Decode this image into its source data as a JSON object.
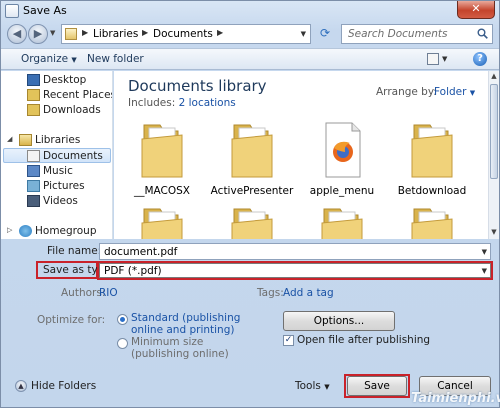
{
  "window": {
    "title": "Save As",
    "close_glyph": "✕"
  },
  "nav": {
    "back_glyph": "◀",
    "forward_glyph": "▶",
    "breadcrumb": [
      "Libraries",
      "Documents"
    ],
    "search_placeholder": "Search Documents"
  },
  "toolbar": {
    "organize": "Organize",
    "new_folder": "New folder",
    "help": "?"
  },
  "sidebar": {
    "items": [
      {
        "label": "Desktop",
        "icon": "desktop-icon"
      },
      {
        "label": "Recent Places",
        "icon": "recent-places-icon"
      },
      {
        "label": "Downloads",
        "icon": "downloads-icon"
      },
      {
        "label": "Libraries",
        "icon": "libraries-icon"
      },
      {
        "label": "Documents",
        "icon": "documents-icon",
        "selected": true
      },
      {
        "label": "Music",
        "icon": "music-icon"
      },
      {
        "label": "Pictures",
        "icon": "pictures-icon"
      },
      {
        "label": "Videos",
        "icon": "videos-icon"
      },
      {
        "label": "Homegroup",
        "icon": "homegroup-icon"
      }
    ]
  },
  "library": {
    "title": "Documents library",
    "includes_label": "Includes:",
    "includes_link": "2 locations",
    "arrange_label": "Arrange by:",
    "arrange_value": "Folder"
  },
  "files": [
    {
      "name": "__MACOSX",
      "type": "folder"
    },
    {
      "name": "ActivePresenter",
      "type": "folder"
    },
    {
      "name": "apple_menu",
      "type": "firefox-folder"
    },
    {
      "name": "Betdownload",
      "type": "folder"
    },
    {
      "name": "",
      "type": "folder"
    },
    {
      "name": "",
      "type": "folder"
    },
    {
      "name": "",
      "type": "folder"
    },
    {
      "name": "",
      "type": "folder"
    }
  ],
  "form": {
    "file_name_label": "File name:",
    "file_name_value": "document.pdf",
    "save_type_label": "Save as type:",
    "save_type_value": "PDF (*.pdf)",
    "authors_label": "Authors:",
    "authors_value": "RIO",
    "tags_label": "Tags:",
    "tags_value": "Add a tag",
    "optimize_label": "Optimize for:",
    "optimize_standard_line1": "Standard (publishing",
    "optimize_standard_line2": "online and printing)",
    "optimize_minimum_line1": "Minimum size",
    "optimize_minimum_line2": "(publishing online)",
    "options_button": "Options...",
    "open_after_label": "Open file after publishing",
    "open_after_checked": true
  },
  "footer": {
    "hide_folders": "Hide Folders",
    "tools": "Tools",
    "save": "Save",
    "cancel": "Cancel",
    "watermark": "Taimienphi.vn"
  },
  "colors": {
    "highlight": "#c9222a",
    "link": "#1a52a5",
    "folder": "#e9c660"
  }
}
